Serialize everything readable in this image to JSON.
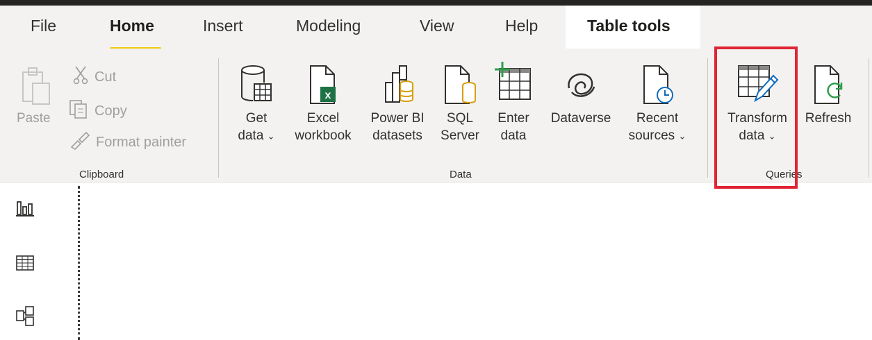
{
  "tabs": [
    {
      "label": "File"
    },
    {
      "label": "Home",
      "active": true
    },
    {
      "label": "Insert"
    },
    {
      "label": "Modeling"
    },
    {
      "label": "View"
    },
    {
      "label": "Help"
    },
    {
      "label": "Table tools",
      "contextual": true
    }
  ],
  "clipboard": {
    "paste": "Paste",
    "cut": "Cut",
    "copy": "Copy",
    "format_painter": "Format painter",
    "group_label": "Clipboard"
  },
  "data_group": {
    "get_data": [
      "Get",
      "data"
    ],
    "excel": [
      "Excel",
      "workbook"
    ],
    "powerbi": [
      "Power BI",
      "datasets"
    ],
    "sql": [
      "SQL",
      "Server"
    ],
    "enter": [
      "Enter",
      "data"
    ],
    "dataverse": [
      "Dataverse"
    ],
    "recent": [
      "Recent",
      "sources"
    ],
    "group_label": "Data"
  },
  "queries_group": {
    "transform": [
      "Transform",
      "data"
    ],
    "refresh": [
      "Refresh"
    ],
    "group_label": "Queries"
  },
  "rail": {
    "report_icon": "bar-chart-icon",
    "data_icon": "table-grid-icon",
    "model_icon": "model-icon"
  },
  "colors": {
    "accent_underline": "#f2c811",
    "highlight_box": "#e02433",
    "excel_green": "#1e7145",
    "refresh_green": "#2e9e4a"
  }
}
